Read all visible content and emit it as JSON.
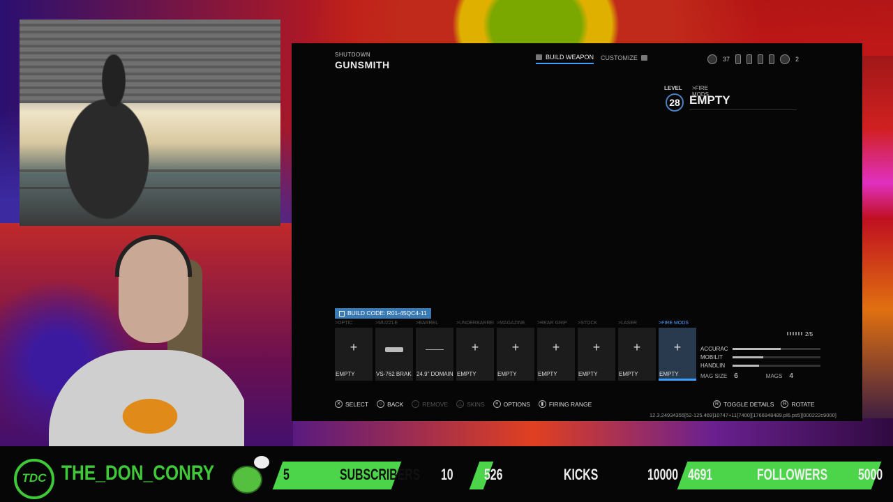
{
  "game": {
    "subtitle": "SHUTDOWN",
    "title": "GUNSMITH",
    "tabs": [
      {
        "label": "BUILD WEAPON",
        "active": true
      },
      {
        "label": "CUSTOMIZE",
        "active": false
      }
    ],
    "topright": {
      "count1": "37",
      "count2": "2"
    },
    "level": {
      "label": "LEVEL",
      "value": "28",
      "category": ">FIRE MODS",
      "name": "EMPTY"
    },
    "build_code": "BUILD CODE: R01-45QC4-11",
    "slots": [
      {
        "category": ">OPTIC",
        "name": "EMPTY",
        "kind": "plus",
        "active": false
      },
      {
        "category": ">MUZZLE",
        "name": "VS-762 BRAK",
        "kind": "attachment",
        "active": false
      },
      {
        "category": ">BARREL",
        "name": "24.9\" DOMAIN",
        "kind": "barrel",
        "active": false
      },
      {
        "category": ">UNDERBARREL",
        "name": "EMPTY",
        "kind": "plus",
        "active": false
      },
      {
        "category": ">MAGAZINE",
        "name": "EMPTY",
        "kind": "plus",
        "active": false
      },
      {
        "category": ">REAR GRIP",
        "name": "EMPTY",
        "kind": "plus",
        "active": false
      },
      {
        "category": ">STOCK",
        "name": "EMPTY",
        "kind": "plus",
        "active": false
      },
      {
        "category": ">LASER",
        "name": "EMPTY",
        "kind": "plus",
        "active": false
      },
      {
        "category": ">FIRE MODS",
        "name": "EMPTY",
        "kind": "plus",
        "active": true
      }
    ],
    "stats": {
      "page": "2/5",
      "rows": [
        {
          "label": "ACCURAC",
          "value": 0.55
        },
        {
          "label": "MOBILIT",
          "value": 0.35
        },
        {
          "label": "HANDLIN",
          "value": 0.3
        }
      ],
      "mag_size_label": "MAG SIZE",
      "mag_size": "6",
      "mags_label": "MAGS",
      "mags": "4"
    },
    "prompts": [
      {
        "icon": "✕",
        "label": "SELECT",
        "dim": false
      },
      {
        "icon": "○",
        "label": "BACK",
        "dim": false
      },
      {
        "icon": "□",
        "label": "REMOVE",
        "dim": true
      },
      {
        "icon": "△",
        "label": "SKINS",
        "dim": true
      },
      {
        "icon": "≡",
        "label": "OPTIONS",
        "dim": false
      },
      {
        "icon": "▮",
        "label": "FIRING RANGE",
        "dim": false
      }
    ],
    "prompts_right": [
      {
        "icon": "R",
        "label": "TOGGLE DETAILS"
      },
      {
        "icon": "R",
        "label": "ROTATE"
      }
    ],
    "footer_id": "12.3.24934355[52-125.469]10747+11[7400][1766948489.pl6.ps5][000222c9000]"
  },
  "overlay": {
    "channel": "THE_DON_CONRY",
    "logo": "TDC",
    "subs_current": "5",
    "subs_label": "SUBSCRIBERS",
    "subs_goal": "10",
    "kicks_current": "526",
    "kicks_label": "KICKS",
    "kicks_goal": "10000",
    "followers_current": "4691",
    "followers_label": "FOLLOWERS",
    "followers_goal": "5000",
    "accent": "#4cd44a"
  }
}
